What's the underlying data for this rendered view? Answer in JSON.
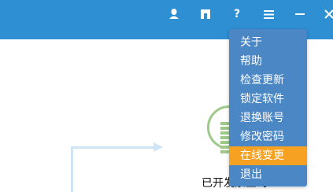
{
  "titlebar": {
    "buttons": [
      {
        "name": "skin-icon"
      },
      {
        "name": "bookmark-icon"
      },
      {
        "name": "help-icon",
        "glyph": "?"
      },
      {
        "name": "menu-icon"
      },
      {
        "name": "minimize-icon"
      },
      {
        "name": "close-icon"
      }
    ],
    "help_glyph": "?"
  },
  "menu": {
    "items": [
      {
        "label": "关于"
      },
      {
        "label": "帮助"
      },
      {
        "label": "检查更新"
      },
      {
        "label": "锁定软件"
      },
      {
        "label": "退换账号"
      },
      {
        "label": "修改密码"
      },
      {
        "label": "在线变更",
        "highlighted": true
      },
      {
        "label": "退出"
      }
    ]
  },
  "content": {
    "status_text": "已开发票查询"
  },
  "colors": {
    "titlebar": "#2f8fd3",
    "menu_bg": "#4b87c4",
    "menu_highlight": "#f7a123",
    "status_ring": "#9ec98a",
    "flow_line": "#cfe4f5"
  }
}
